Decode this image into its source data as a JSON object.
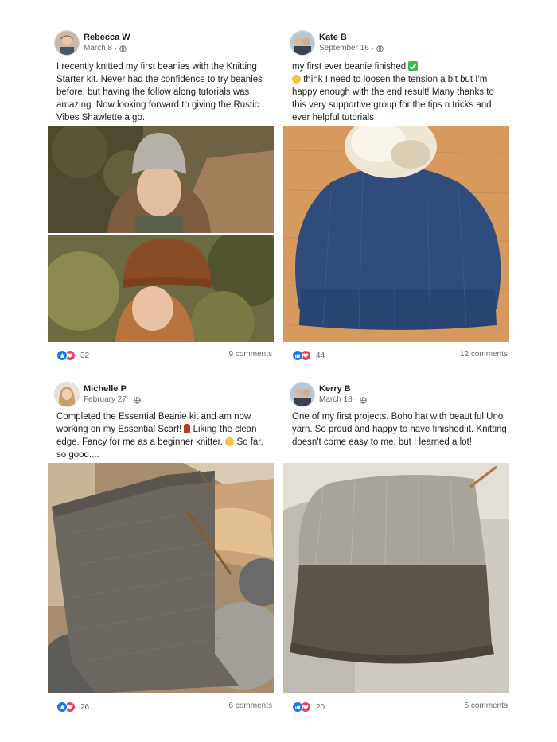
{
  "posts": [
    {
      "author": "Rebecca W",
      "date": "March 8 ·",
      "text": "I recently knitted my first beanies with the Knitting Starter kit. Never had the confidence to try beanies before, but having the follow along tutorials was amazing. Now looking forward to giving the Rustic Vibes Shawlette a go.",
      "reactions": "32",
      "comments": "9 comments"
    },
    {
      "author": "Kate B",
      "date": "September 16 ·",
      "text_1": "my first ever beanie finished",
      "text_2": "think I need to loosen the tension a bit but I'm happy enough with the end result! Many thanks to this very supportive group for the tips n tricks and ever helpful tutorials",
      "reactions": "44",
      "comments": "12 comments"
    },
    {
      "author": "Michelle P",
      "date": "February 27 ·",
      "text_1": "Completed the Essential Beanie kit and am now working on my Essential Scarf!",
      "text_2": "Liking the clean edge. Fancy for me as a beginner knitter.",
      "text_3": "So far, so good....",
      "reactions": "26",
      "comments": "6 comments"
    },
    {
      "author": "Kerry B",
      "date": "March 18 ·",
      "text": "One of my first projects. Boho hat with beautiful Uno yarn. So proud and happy to have finished it. Knitting doesn't come easy to me, but I learned a lot!",
      "reactions": "20",
      "comments": "5 comments"
    }
  ],
  "icons": {
    "globe": "globe-icon",
    "like": "like-reaction-icon",
    "love": "love-reaction-icon"
  },
  "colors": {
    "like": "#1877f2",
    "love": "#f33e58",
    "secondary_text": "#65676b"
  }
}
